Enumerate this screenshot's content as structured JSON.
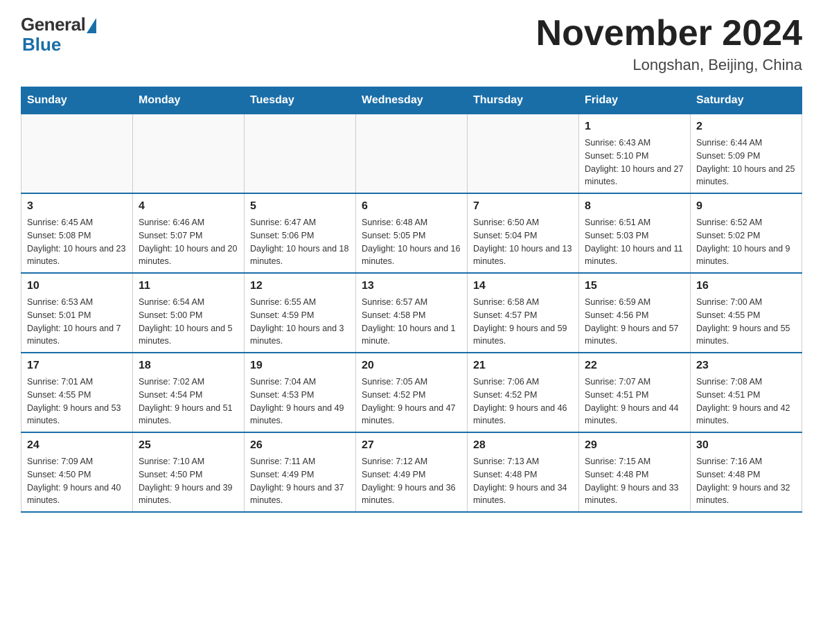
{
  "header": {
    "logo_general": "General",
    "logo_blue": "Blue",
    "month_title": "November 2024",
    "location": "Longshan, Beijing, China"
  },
  "weekdays": [
    "Sunday",
    "Monday",
    "Tuesday",
    "Wednesday",
    "Thursday",
    "Friday",
    "Saturday"
  ],
  "weeks": [
    [
      {
        "day": "",
        "sunrise": "",
        "sunset": "",
        "daylight": ""
      },
      {
        "day": "",
        "sunrise": "",
        "sunset": "",
        "daylight": ""
      },
      {
        "day": "",
        "sunrise": "",
        "sunset": "",
        "daylight": ""
      },
      {
        "day": "",
        "sunrise": "",
        "sunset": "",
        "daylight": ""
      },
      {
        "day": "",
        "sunrise": "",
        "sunset": "",
        "daylight": ""
      },
      {
        "day": "1",
        "sunrise": "Sunrise: 6:43 AM",
        "sunset": "Sunset: 5:10 PM",
        "daylight": "Daylight: 10 hours and 27 minutes."
      },
      {
        "day": "2",
        "sunrise": "Sunrise: 6:44 AM",
        "sunset": "Sunset: 5:09 PM",
        "daylight": "Daylight: 10 hours and 25 minutes."
      }
    ],
    [
      {
        "day": "3",
        "sunrise": "Sunrise: 6:45 AM",
        "sunset": "Sunset: 5:08 PM",
        "daylight": "Daylight: 10 hours and 23 minutes."
      },
      {
        "day": "4",
        "sunrise": "Sunrise: 6:46 AM",
        "sunset": "Sunset: 5:07 PM",
        "daylight": "Daylight: 10 hours and 20 minutes."
      },
      {
        "day": "5",
        "sunrise": "Sunrise: 6:47 AM",
        "sunset": "Sunset: 5:06 PM",
        "daylight": "Daylight: 10 hours and 18 minutes."
      },
      {
        "day": "6",
        "sunrise": "Sunrise: 6:48 AM",
        "sunset": "Sunset: 5:05 PM",
        "daylight": "Daylight: 10 hours and 16 minutes."
      },
      {
        "day": "7",
        "sunrise": "Sunrise: 6:50 AM",
        "sunset": "Sunset: 5:04 PM",
        "daylight": "Daylight: 10 hours and 13 minutes."
      },
      {
        "day": "8",
        "sunrise": "Sunrise: 6:51 AM",
        "sunset": "Sunset: 5:03 PM",
        "daylight": "Daylight: 10 hours and 11 minutes."
      },
      {
        "day": "9",
        "sunrise": "Sunrise: 6:52 AM",
        "sunset": "Sunset: 5:02 PM",
        "daylight": "Daylight: 10 hours and 9 minutes."
      }
    ],
    [
      {
        "day": "10",
        "sunrise": "Sunrise: 6:53 AM",
        "sunset": "Sunset: 5:01 PM",
        "daylight": "Daylight: 10 hours and 7 minutes."
      },
      {
        "day": "11",
        "sunrise": "Sunrise: 6:54 AM",
        "sunset": "Sunset: 5:00 PM",
        "daylight": "Daylight: 10 hours and 5 minutes."
      },
      {
        "day": "12",
        "sunrise": "Sunrise: 6:55 AM",
        "sunset": "Sunset: 4:59 PM",
        "daylight": "Daylight: 10 hours and 3 minutes."
      },
      {
        "day": "13",
        "sunrise": "Sunrise: 6:57 AM",
        "sunset": "Sunset: 4:58 PM",
        "daylight": "Daylight: 10 hours and 1 minute."
      },
      {
        "day": "14",
        "sunrise": "Sunrise: 6:58 AM",
        "sunset": "Sunset: 4:57 PM",
        "daylight": "Daylight: 9 hours and 59 minutes."
      },
      {
        "day": "15",
        "sunrise": "Sunrise: 6:59 AM",
        "sunset": "Sunset: 4:56 PM",
        "daylight": "Daylight: 9 hours and 57 minutes."
      },
      {
        "day": "16",
        "sunrise": "Sunrise: 7:00 AM",
        "sunset": "Sunset: 4:55 PM",
        "daylight": "Daylight: 9 hours and 55 minutes."
      }
    ],
    [
      {
        "day": "17",
        "sunrise": "Sunrise: 7:01 AM",
        "sunset": "Sunset: 4:55 PM",
        "daylight": "Daylight: 9 hours and 53 minutes."
      },
      {
        "day": "18",
        "sunrise": "Sunrise: 7:02 AM",
        "sunset": "Sunset: 4:54 PM",
        "daylight": "Daylight: 9 hours and 51 minutes."
      },
      {
        "day": "19",
        "sunrise": "Sunrise: 7:04 AM",
        "sunset": "Sunset: 4:53 PM",
        "daylight": "Daylight: 9 hours and 49 minutes."
      },
      {
        "day": "20",
        "sunrise": "Sunrise: 7:05 AM",
        "sunset": "Sunset: 4:52 PM",
        "daylight": "Daylight: 9 hours and 47 minutes."
      },
      {
        "day": "21",
        "sunrise": "Sunrise: 7:06 AM",
        "sunset": "Sunset: 4:52 PM",
        "daylight": "Daylight: 9 hours and 46 minutes."
      },
      {
        "day": "22",
        "sunrise": "Sunrise: 7:07 AM",
        "sunset": "Sunset: 4:51 PM",
        "daylight": "Daylight: 9 hours and 44 minutes."
      },
      {
        "day": "23",
        "sunrise": "Sunrise: 7:08 AM",
        "sunset": "Sunset: 4:51 PM",
        "daylight": "Daylight: 9 hours and 42 minutes."
      }
    ],
    [
      {
        "day": "24",
        "sunrise": "Sunrise: 7:09 AM",
        "sunset": "Sunset: 4:50 PM",
        "daylight": "Daylight: 9 hours and 40 minutes."
      },
      {
        "day": "25",
        "sunrise": "Sunrise: 7:10 AM",
        "sunset": "Sunset: 4:50 PM",
        "daylight": "Daylight: 9 hours and 39 minutes."
      },
      {
        "day": "26",
        "sunrise": "Sunrise: 7:11 AM",
        "sunset": "Sunset: 4:49 PM",
        "daylight": "Daylight: 9 hours and 37 minutes."
      },
      {
        "day": "27",
        "sunrise": "Sunrise: 7:12 AM",
        "sunset": "Sunset: 4:49 PM",
        "daylight": "Daylight: 9 hours and 36 minutes."
      },
      {
        "day": "28",
        "sunrise": "Sunrise: 7:13 AM",
        "sunset": "Sunset: 4:48 PM",
        "daylight": "Daylight: 9 hours and 34 minutes."
      },
      {
        "day": "29",
        "sunrise": "Sunrise: 7:15 AM",
        "sunset": "Sunset: 4:48 PM",
        "daylight": "Daylight: 9 hours and 33 minutes."
      },
      {
        "day": "30",
        "sunrise": "Sunrise: 7:16 AM",
        "sunset": "Sunset: 4:48 PM",
        "daylight": "Daylight: 9 hours and 32 minutes."
      }
    ]
  ]
}
